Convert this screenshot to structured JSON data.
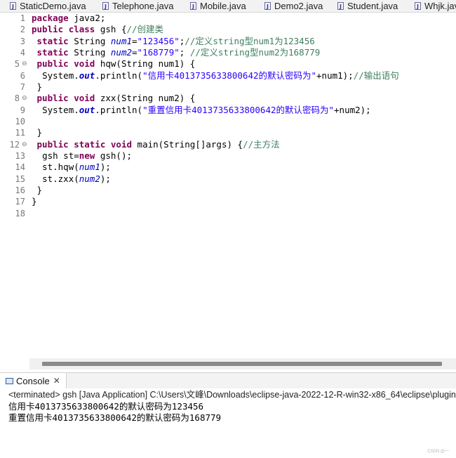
{
  "tabs": [
    {
      "label": "StaticDemo.java"
    },
    {
      "label": "Telephone.java"
    },
    {
      "label": "Mobile.java"
    },
    {
      "label": "Demo2.java"
    },
    {
      "label": "Student.java"
    },
    {
      "label": "Whjk.java"
    }
  ],
  "editor": {
    "line_numbers": [
      "1",
      "2",
      "3",
      "4",
      "5",
      "6",
      "7",
      "8",
      "9",
      "10",
      "11",
      "12",
      "13",
      "14",
      "15",
      "16",
      "17",
      "18"
    ],
    "tokens": {
      "package": "package",
      "pkg_name": " java2;",
      "public": "public",
      "class": "class",
      "class_decl": " gsh {",
      "c_create_class": "//创建类",
      "static": "static",
      "string_type": " String ",
      "num1": "num1",
      "num2": "num2",
      "eq": "=",
      "s_123456": "\"123456\"",
      "semi": ";",
      "c_num1": "//定义string型num1为123456",
      "s_168779": "\"168779\"",
      "semi_sp": "; ",
      "c_num2": "//定义string型num2为168779",
      "void": "void",
      "hqw_sig": " hqw(String num1) {",
      "system": "System.",
      "out": "out",
      "println_open": ".println(",
      "s_msg1": "\"信用卡4013735633800642的默认密码为\"",
      "plus_num1_close": "+num1);",
      "c_output": "//输出语句",
      "close_brace": "}",
      "zxx_sig": " zxx(String num2) {",
      "s_msg2": "\"重置信用卡4013735633800642的默认密码为\"",
      "plus_num2_close": "+num2);",
      "main_sig": " main(String[]args) {",
      "c_main": "//主方法",
      "gsh_sp": "gsh st=",
      "new": "new",
      "new_gsh": " gsh();",
      "st_hqw": "st.hqw(",
      "st_zxx": "st.zxx(",
      "close_paren": ");"
    }
  },
  "console": {
    "tab_label": "Console",
    "close_glyph": "✕",
    "terminated": "<terminated> gsh [Java Application] C:\\Users\\文峰\\Downloads\\eclipse-java-2022-12-R-win32-x86_64\\eclipse\\plugins\\",
    "output_lines": [
      "信用卡4013735633800642的默认密码为123456",
      "重置信用卡4013735633800642的默认密码为168779"
    ]
  },
  "watermark": "CSDN @一"
}
